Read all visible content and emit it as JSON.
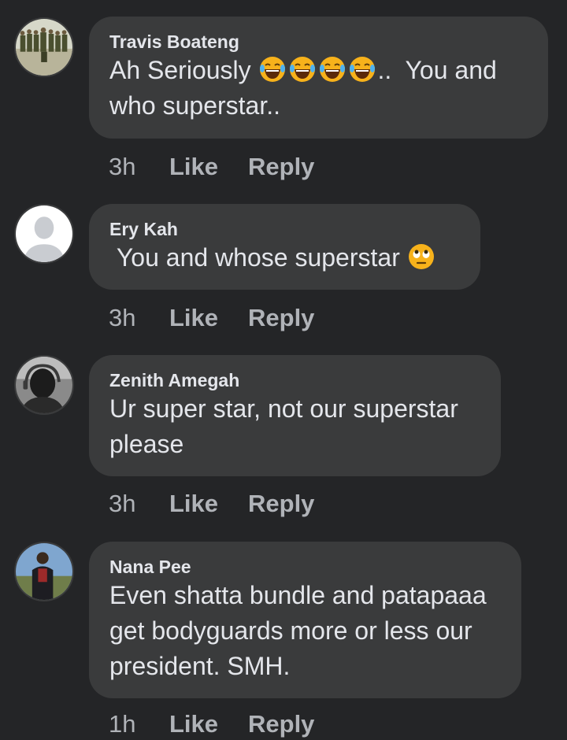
{
  "comments": [
    {
      "author": "Travis Boateng",
      "text_prefix": "Ah Seriously ",
      "emoji": [
        "face-with-tears-of-joy",
        "face-with-tears-of-joy",
        "face-with-tears-of-joy",
        "face-with-tears-of-joy"
      ],
      "text_suffix": "..  You and who superstar..",
      "time": "3h",
      "like": "Like",
      "reply": "Reply"
    },
    {
      "author": "Ery Kah",
      "text_prefix": " You and whose superstar ",
      "emoji": [
        "face-with-rolling-eyes"
      ],
      "time": "3h",
      "like": "Like",
      "reply": "Reply"
    },
    {
      "author": "Zenith Amegah",
      "text": "Ur super star, not our superstar please",
      "time": "3h",
      "like": "Like",
      "reply": "Reply"
    },
    {
      "author": "Nana Pee",
      "text": "Even shatta bundle and patapaaa get bodyguards more or less our president. SMH.",
      "time": "1h",
      "like": "Like",
      "reply": "Reply"
    }
  ],
  "colors": {
    "background": "#242527",
    "bubble": "#3a3b3c",
    "primary_text": "#e4e6eb",
    "secondary_text": "#b0b3b8"
  }
}
